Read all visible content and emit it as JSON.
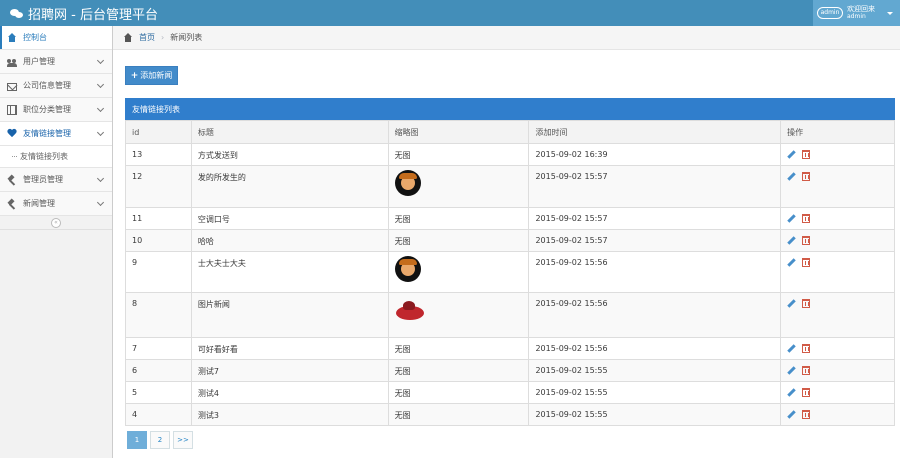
{
  "app": {
    "title": "招聘网 - 后台管理平台"
  },
  "user": {
    "avatar_label": "admin",
    "greeting": "欢迎回来",
    "name": "admin"
  },
  "sidebar": {
    "items": [
      {
        "label": "控制台",
        "icon": "home-icon"
      },
      {
        "label": "用户管理",
        "icon": "users-icon"
      },
      {
        "label": "公司信息管理",
        "icon": "envelope-icon"
      },
      {
        "label": "职位分类管理",
        "icon": "film-icon"
      },
      {
        "label": "友情链接管理",
        "icon": "heart-icon"
      },
      {
        "label": "管理员管理",
        "icon": "gavel-icon"
      },
      {
        "label": "新闻管理",
        "icon": "gavel-icon"
      }
    ],
    "subitem": {
      "label": "友情链接列表"
    },
    "collapse_glyph": "«"
  },
  "breadcrumb": {
    "home": "首页",
    "current": "新闻列表"
  },
  "toolbar": {
    "add_label": "添加新闻"
  },
  "table": {
    "heading": "友情链接列表",
    "columns": [
      "id",
      "标题",
      "缩略图",
      "添加时间",
      "操作"
    ],
    "rows": [
      {
        "id": "13",
        "title": "方式发送到",
        "thumb": "无图",
        "time": "2015-09-02 16:39"
      },
      {
        "id": "12",
        "title": "发的所发生的",
        "thumb": "",
        "time": "2015-09-02 15:57"
      },
      {
        "id": "11",
        "title": "空调口号",
        "thumb": "无图",
        "time": "2015-09-02 15:57"
      },
      {
        "id": "10",
        "title": "哈哈",
        "thumb": "无图",
        "time": "2015-09-02 15:57"
      },
      {
        "id": "9",
        "title": "士大夫士大夫",
        "thumb": "",
        "time": "2015-09-02 15:56"
      },
      {
        "id": "8",
        "title": "图片新闻",
        "thumb": "",
        "time": "2015-09-02 15:56"
      },
      {
        "id": "7",
        "title": "可好看好看",
        "thumb": "无图",
        "time": "2015-09-02 15:56"
      },
      {
        "id": "6",
        "title": "测试7",
        "thumb": "无图",
        "time": "2015-09-02 15:55"
      },
      {
        "id": "5",
        "title": "测试4",
        "thumb": "无图",
        "time": "2015-09-02 15:55"
      },
      {
        "id": "4",
        "title": "测试3",
        "thumb": "无图",
        "time": "2015-09-02 15:55"
      }
    ]
  },
  "pagination": {
    "pages": [
      "1",
      "2",
      ">>"
    ],
    "active": "1"
  },
  "colors": {
    "primary": "#438eb9",
    "table_header": "#307ecc",
    "button": "#428bca",
    "edit": "#478fca",
    "delete": "#d15b47"
  }
}
